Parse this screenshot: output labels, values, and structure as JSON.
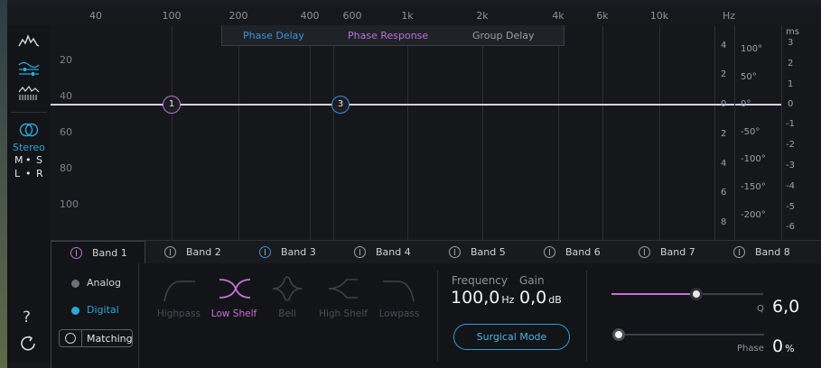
{
  "freq_axis": {
    "labels": [
      "40",
      "100",
      "200",
      "400",
      "600",
      "1k",
      "2k",
      "4k",
      "6k",
      "10k",
      "Hz"
    ]
  },
  "toolbar": {
    "stereo_label": "Stereo",
    "ms_mode": [
      "M",
      "•",
      "S"
    ],
    "lr_mode": [
      "L",
      "•",
      "R"
    ],
    "help_label": "?"
  },
  "graph": {
    "db_labels": [
      "20",
      "40",
      "60",
      "80",
      "100"
    ],
    "display_tabs": [
      "Phase Delay",
      "Phase Response",
      "Group Delay"
    ],
    "right_axis_a": [
      "4",
      "2",
      "0",
      "2",
      "4",
      "6",
      "8"
    ],
    "right_axis_deg": [
      "100°",
      "50°",
      "0°",
      "-50°",
      "-100°",
      "-150°",
      "-200°"
    ],
    "ms_unit": "ms",
    "ms_labels": [
      "3",
      "2",
      "1",
      "0",
      "-1",
      "-2",
      "-3",
      "-4",
      "-5",
      "-6"
    ],
    "nodes": [
      "1",
      "3"
    ]
  },
  "band_tabs": [
    "Band 1",
    "Band 2",
    "Band 3",
    "Band 4",
    "Band 5",
    "Band 6",
    "Band 7",
    "Band 8"
  ],
  "mode": {
    "analog": "Analog",
    "digital": "Digital",
    "matching": "Matching",
    "selected": "Digital"
  },
  "shapes": [
    "Highpass",
    "Low Shelf",
    "Bell",
    "High Shelf",
    "Lowpass"
  ],
  "selected_shape": "Low Shelf",
  "params": {
    "frequency_label": "Frequency",
    "gain_label": "Gain",
    "frequency_value": "100,0",
    "frequency_unit": "Hz",
    "gain_value": "0,0",
    "gain_unit": "dB",
    "surgical_mode": "Surgical Mode",
    "q_label": "Q",
    "q_value": "6,0",
    "phase_label": "Phase",
    "phase_value": "0",
    "phase_unit": "%"
  },
  "colors": {
    "accent": "#2aa8d8",
    "low_shelf": "#c86fd8",
    "node1": "#c071d4",
    "node3": "#3a8fe0",
    "surgical": "#2b9fd4"
  }
}
